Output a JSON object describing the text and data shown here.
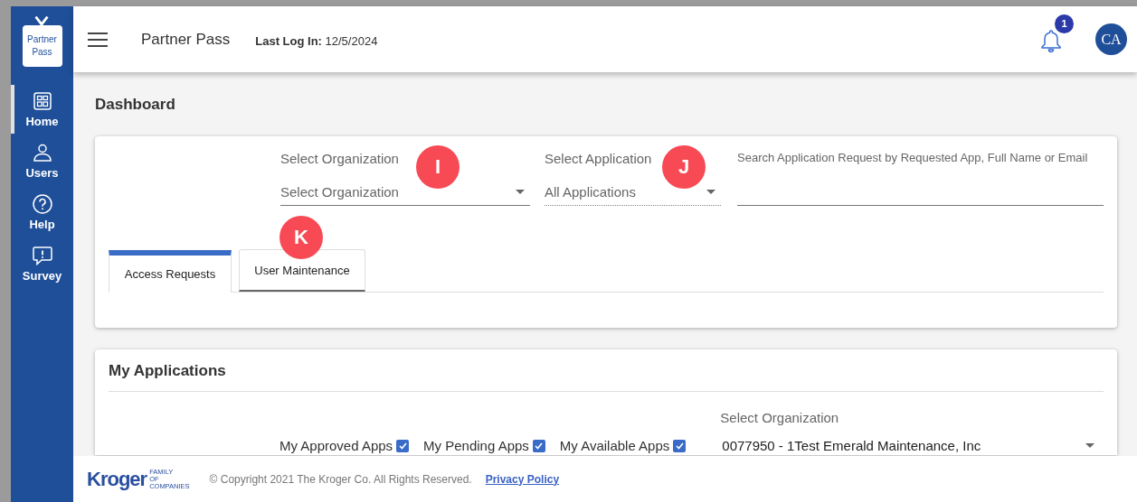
{
  "logo": {
    "lines": [
      "Partner",
      "Pass"
    ]
  },
  "sidebar": {
    "items": [
      {
        "label": "Home",
        "selected": true
      },
      {
        "label": "Users",
        "selected": false
      },
      {
        "label": "Help",
        "selected": false
      },
      {
        "label": "Survey",
        "selected": false
      }
    ]
  },
  "header": {
    "title": "Partner Pass",
    "last_login_label": "Last Log In:",
    "last_login": "12/5/2024",
    "notification_count": "1",
    "avatar": "CA"
  },
  "page_title": "Dashboard",
  "filters": [
    {
      "kind": "dropdown",
      "label": "Select Organization",
      "value": "Select Organization",
      "disabled": false,
      "callout": "I"
    },
    {
      "kind": "dropdown",
      "label": "Select Application",
      "value": "All Applications",
      "disabled": true,
      "callout": "J"
    },
    {
      "kind": "text",
      "label": "Search Application Request by Requested App, Full Name or Email"
    }
  ],
  "tabs": [
    {
      "label": "Access Requests",
      "selected": true
    },
    {
      "label": "User Maintenance",
      "selected": false,
      "callout": "K"
    }
  ],
  "my_applications": {
    "title": "My Applications",
    "checkboxes": [
      {
        "label": "My Approved Apps",
        "checked": true
      },
      {
        "label": "My Pending Apps",
        "checked": true
      },
      {
        "label": "My Available Apps",
        "checked": true
      }
    ],
    "organization": {
      "label": "Select Organization",
      "value": "0077950 - 1Test Emerald Maintenance, Inc"
    }
  },
  "footer": {
    "brand": "Kroger",
    "tagline": [
      "FAMILY",
      "OF",
      "COMPANIES"
    ],
    "copyright": "© Copyright 2021 The Kroger Co. All Rights Reserved.",
    "link": "Privacy Policy"
  }
}
